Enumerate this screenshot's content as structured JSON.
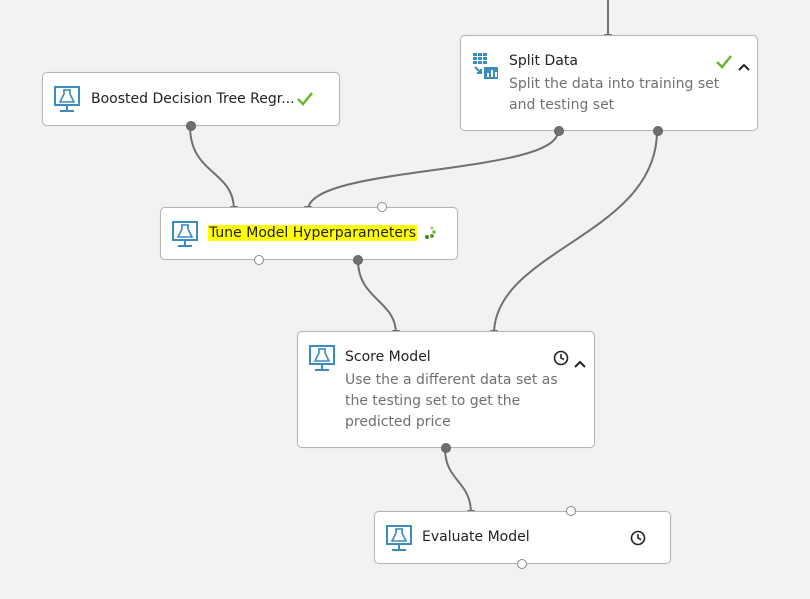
{
  "colors": {
    "canvas_bg": "#f2f2f2",
    "node_border": "#b5b5b5",
    "icon_blue": "#3c8cc0",
    "success_green": "#6cb52d",
    "highlight_yellow": "#ffff00",
    "wire": "#707070"
  },
  "nodes": {
    "boosted": {
      "title": "Boosted Decision Tree Regr...",
      "status_icon": "check-icon"
    },
    "split": {
      "title": "Split Data",
      "description": "Split the data into training set and testing set",
      "status_icon": "check-icon",
      "toggle_icon": "chevron-up-icon"
    },
    "tune": {
      "title": "Tune Model Hyperparameters",
      "status_icon": "running-spinner-icon"
    },
    "score": {
      "title": "Score Model",
      "description": "Use the a different data set as the testing set to get the predicted price",
      "status_icon": "clock-icon",
      "toggle_icon": "chevron-up-icon"
    },
    "evaluate": {
      "title": "Evaluate Model",
      "status_icon": "clock-icon"
    }
  }
}
